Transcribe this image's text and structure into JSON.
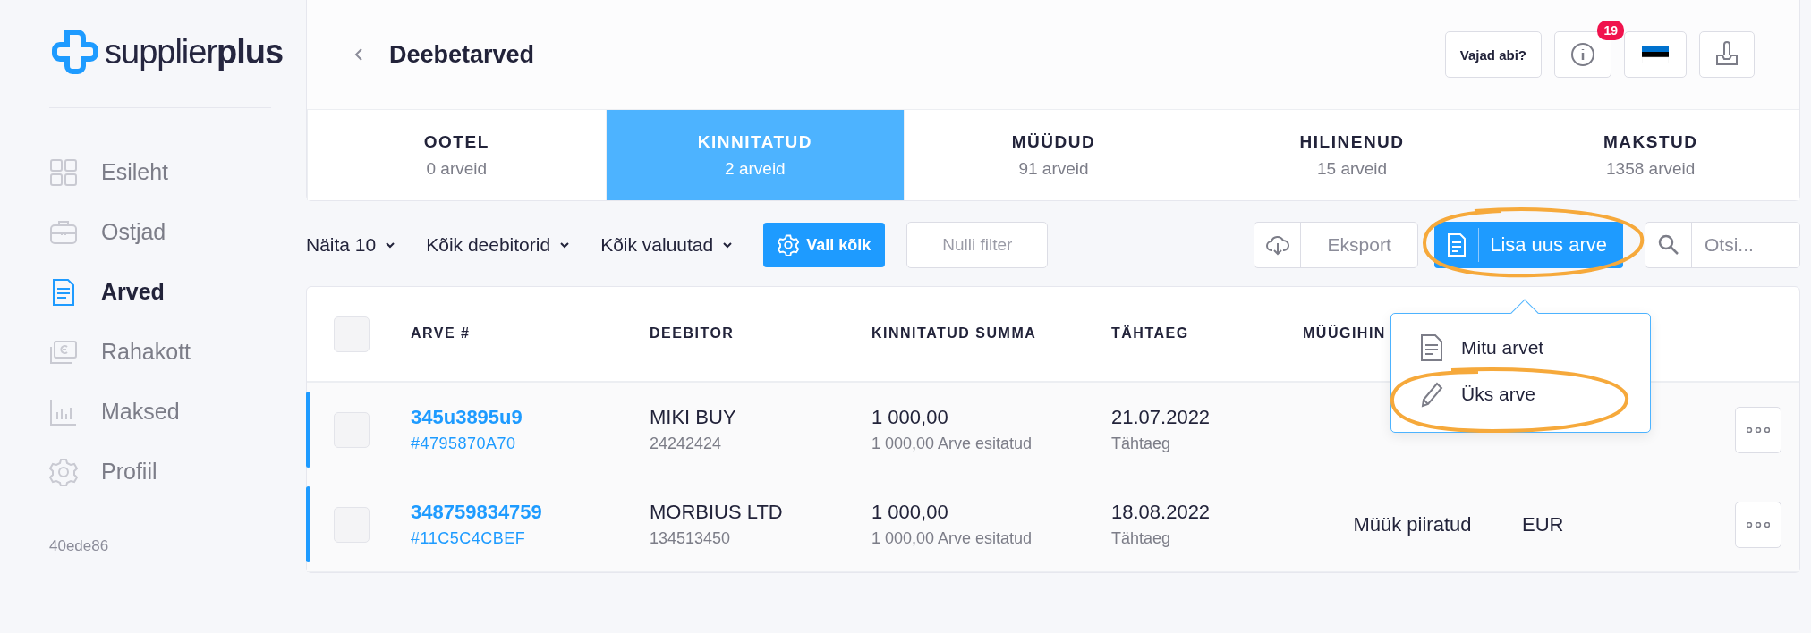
{
  "brand": {
    "light": "supplier",
    "bold": "plus"
  },
  "nav": [
    {
      "label": "Esileht",
      "kind": "grid",
      "selected": false
    },
    {
      "label": "Ostjad",
      "kind": "briefcase",
      "selected": false
    },
    {
      "label": "Arved",
      "kind": "document",
      "selected": true
    },
    {
      "label": "Rahakott",
      "kind": "wallet",
      "selected": false
    },
    {
      "label": "Maksed",
      "kind": "chart",
      "selected": false
    },
    {
      "label": "Profiil",
      "kind": "gear",
      "selected": false
    }
  ],
  "version": "40ede86",
  "page_title": "Deebetarved",
  "header_actions": {
    "help": "Vajad abi?",
    "notifications": "19"
  },
  "status_tabs": [
    {
      "label": "OOTEL",
      "count": "0 arveid",
      "selected": false
    },
    {
      "label": "KINNITATUD",
      "count": "2 arveid",
      "selected": true
    },
    {
      "label": "MÜÜDUD",
      "count": "91 arveid",
      "selected": false
    },
    {
      "label": "HILINENUD",
      "count": "15 arveid",
      "selected": false
    },
    {
      "label": "MAKSTUD",
      "count": "1358 arveid",
      "selected": false
    }
  ],
  "filters": [
    "Näita 10",
    "Kõik deebitorid",
    "Kõik valuutad"
  ],
  "select_all": "Vali kõik",
  "reset_filter": "Nulli filter",
  "export": "Eksport",
  "add_invoice": "Lisa uus arve",
  "search": {
    "placeholder": "Otsi..."
  },
  "table": {
    "all_checked": false,
    "columns": [
      "ARVE #",
      "DEEBITOR",
      "KINNITATUD SUMMA",
      "TÄHTAEG",
      "MÜÜGIHIN"
    ],
    "rows": [
      {
        "number": "345u3895u9",
        "ref": "#4795870A70",
        "debtor": "MIKI BUY",
        "debtor_code": "24242424",
        "amount": "1 000,00",
        "amount_note": "1 000,00 Arve esitatud",
        "due": "21.07.2022",
        "due_label": "Tähtaeg",
        "checked": false
      },
      {
        "number": "348759834759",
        "ref": "#11C5C4CBEF",
        "debtor": "MORBIUS LTD",
        "debtor_code": "134513450",
        "amount": "1 000,00",
        "amount_note": "1 000,00 Arve esitatud",
        "due": "18.08.2022",
        "due_label": "Tähtaeg",
        "sale": "Müük piiratud",
        "currency": "EUR",
        "checked": false
      }
    ]
  },
  "add_menu": [
    {
      "label": "Mitu arvet",
      "kind": "document"
    },
    {
      "label": "Üks arve",
      "kind": "pencil"
    }
  ]
}
